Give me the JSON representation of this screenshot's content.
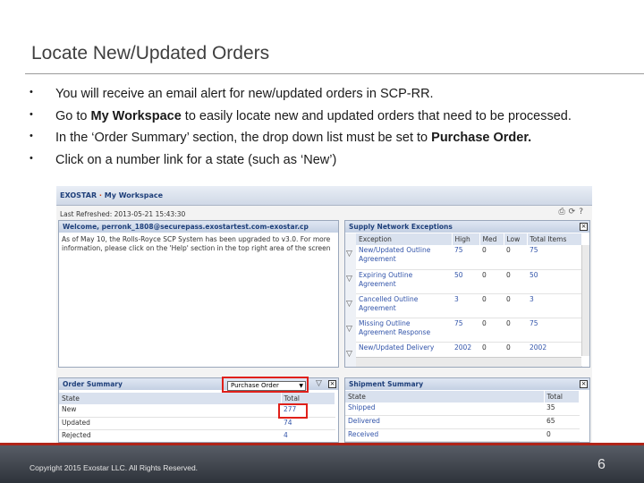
{
  "slide": {
    "title": "Locate New/Updated Orders",
    "bullets": [
      {
        "before": "You will receive an email alert for new/updated orders in SCP-RR.",
        "bold": "",
        "after": ""
      },
      {
        "before": "Go to ",
        "bold": "My Workspace",
        "after": " to easily locate new and updated orders that need to be processed."
      },
      {
        "before": "In the ‘Order Summary’ section, the drop down list must be set to ",
        "bold": "Purchase Order.",
        "after": ""
      },
      {
        "before": "Click on a number link for a state (such as ‘New’)",
        "bold": "",
        "after": ""
      }
    ],
    "bullet_glyph": "•",
    "footer": {
      "copyright": "Copyright 2015 Exostar LLC. All Rights Reserved.",
      "page_number": "6"
    }
  },
  "app": {
    "logo": "EXOSTAR",
    "logo_sep": "·",
    "workspace_title": "My Workspace",
    "last_refreshed": "Last Refreshed: 2013-05-21 15:43:30",
    "toolbar_icons": [
      "print-icon",
      "refresh-icon",
      "help-icon"
    ],
    "welcome": {
      "header": "Welcome, perronk_1808@securepass.exostartest.com-exostar.cp",
      "text": "As of May 10, the Rolls-Royce SCP System has been upgraded to v3.0. For more information, please click on the 'Help' section in the top right area of the screen"
    },
    "exceptions": {
      "header": "Supply Network Exceptions",
      "columns": [
        "Exception",
        "High",
        "Med",
        "Low",
        "Total Items"
      ],
      "rows": [
        [
          "New/Updated Outline Agreement",
          "75",
          "0",
          "0",
          "75"
        ],
        [
          "Expiring Outline Agreement",
          "50",
          "0",
          "0",
          "50"
        ],
        [
          "Cancelled Outline Agreement",
          "3",
          "0",
          "0",
          "3"
        ],
        [
          "Missing Outline Agreement Response",
          "75",
          "0",
          "0",
          "75"
        ],
        [
          "New/Updated Delivery",
          "2002",
          "0",
          "0",
          "2002"
        ]
      ]
    },
    "order_summary": {
      "header": "Order Summary",
      "selected_type": "Purchase Order",
      "columns": [
        "State",
        "Total"
      ],
      "rows": [
        [
          "New",
          "277"
        ],
        [
          "Updated",
          "74"
        ],
        [
          "Rejected",
          "4"
        ]
      ]
    },
    "shipment_summary": {
      "header": "Shipment Summary",
      "columns": [
        "State",
        "Total"
      ],
      "rows": [
        [
          "Shipped",
          "35"
        ],
        [
          "Delivered",
          "65"
        ],
        [
          "Received",
          "0"
        ]
      ]
    },
    "close_glyph": "×",
    "accent_red": "#e0201a"
  }
}
